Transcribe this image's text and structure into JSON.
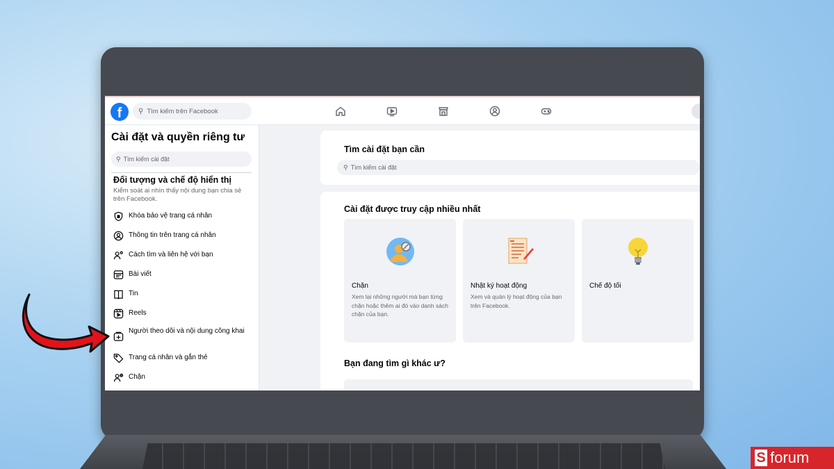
{
  "topbar": {
    "logo": "f",
    "search_placeholder": "Tìm kiếm trên Facebook",
    "nav_icons": [
      "home-icon",
      "watch-icon",
      "marketplace-icon",
      "groups-icon",
      "gaming-icon"
    ]
  },
  "sidebar": {
    "title": "Cài đặt và quyền riêng tư",
    "search_placeholder": "Tìm kiếm cài đặt",
    "section_title": "Đối tượng và chế độ hiển thị",
    "section_desc": "Kiểm soát ai nhìn thấy nội dung bạn chia sẻ trên Facebook.",
    "items": [
      {
        "label": "Khóa bảo vệ trang cá nhân",
        "icon": "shield-icon"
      },
      {
        "label": "Thông tin trên trang cá nhân",
        "icon": "profile-icon"
      },
      {
        "label": "Cách tìm và liên hệ với bạn",
        "icon": "contact-icon"
      },
      {
        "label": "Bài viết",
        "icon": "posts-icon"
      },
      {
        "label": "Tin",
        "icon": "stories-icon"
      },
      {
        "label": "Reels",
        "icon": "reels-icon"
      },
      {
        "label": "Người theo dõi và nội dung công khai",
        "icon": "followers-icon"
      },
      {
        "label": "Trang cá nhân và gắn thẻ",
        "icon": "tag-icon"
      },
      {
        "label": "Chặn",
        "icon": "block-user-icon"
      }
    ]
  },
  "main": {
    "search_card": {
      "title": "Tìm cài đặt bạn cần",
      "search_placeholder": "Tìm kiếm cài đặt"
    },
    "most_visited": {
      "title": "Cài đặt được truy cập nhiều nhất",
      "tiles": [
        {
          "title": "Chặn",
          "desc": "Xem lại những người mà bạn từng chặn hoặc thêm ai đó vào danh sách chặn của bạn.",
          "icon": "blocking-illustration-icon"
        },
        {
          "title": "Nhật ký hoạt động",
          "desc": "Xem và quản lý hoạt động của bạn trên Facebook.",
          "icon": "activity-log-illustration-icon"
        },
        {
          "title": "Chế độ tối",
          "desc": "",
          "icon": "lightbulb-illustration-icon"
        }
      ]
    },
    "other_title": "Bạn đang tìm gì khác ư?"
  },
  "watermark": {
    "letter": "S",
    "text": "forum"
  },
  "colors": {
    "facebook_blue": "#1877f2",
    "arrow_red": "#e3131b",
    "badge_red": "#d7262b"
  }
}
